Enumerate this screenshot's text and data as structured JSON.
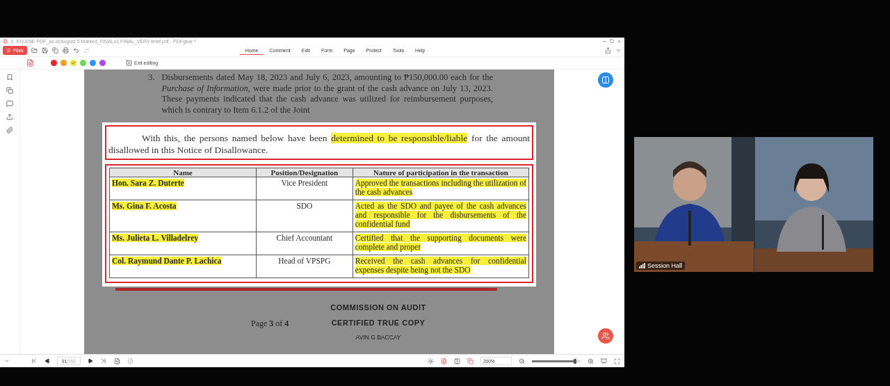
{
  "window": {
    "title": "3. XYLENE PDF_as of August 5 Marked_FINALv1 FINAL_VERY brief.pdf - PDFgear *"
  },
  "files_button": "Files",
  "menu_tabs": [
    {
      "label": "Home",
      "selected": true
    },
    {
      "label": "Comment",
      "selected": false
    },
    {
      "label": "Edit",
      "selected": false
    },
    {
      "label": "Form",
      "selected": false
    },
    {
      "label": "Page",
      "selected": false
    },
    {
      "label": "Protect",
      "selected": false
    },
    {
      "label": "Tools",
      "selected": false
    },
    {
      "label": "Help",
      "selected": false
    }
  ],
  "highlight_colors": [
    {
      "color": "#e8262b",
      "selected": false
    },
    {
      "color": "#f59b1b",
      "selected": false
    },
    {
      "color": "#f5e62a",
      "selected": true
    },
    {
      "color": "#6fd656",
      "selected": false
    },
    {
      "color": "#2d95ee",
      "selected": false
    },
    {
      "color": "#b04be0",
      "selected": false
    }
  ],
  "exit_editing": "Exit editing",
  "document": {
    "item_number": "3.",
    "item_text": "Disbursements dated May 18, 2023 and July 6, 2023, amounting to ₱150,000.00 each for the *Purchase of Information*, were made prior to the grant of the cash advance on July 13, 2023. These payments indicated that the cash advance was utilized for reimbursement purposes, which is contrary to Item 6.1.2 of the Joint",
    "statement": [
      {
        "text": "With this, the persons named below have been ",
        "highlighted": false
      },
      {
        "text": "determined to be responsible/liable",
        "highlighted": true
      },
      {
        "text": " for the amount disallowed in this Notice of Disallowance.",
        "highlighted": false
      }
    ],
    "table": {
      "columns": [
        "Name",
        "Position/Designation",
        "Nature of participation in the transaction"
      ],
      "rows": [
        {
          "name": "Hon. Sara Z. Duterte",
          "position": "Vice President",
          "nature": "Approved the transactions including the utilization of the cash advances",
          "highlighted": true
        },
        {
          "name": "Ms. Gina F. Acosta",
          "position": "SDO",
          "nature": "Acted as the SDO and payee of the cash advances and responsible for the disbursements of the confidential fund",
          "highlighted": true
        },
        {
          "name": "Ms. Julieta L. Villadelrey",
          "position": "Chief Accountant",
          "nature": "Certified that the supporting documents were complete and proper",
          "highlighted": true
        },
        {
          "name": "Col. Raymund Dante P. Lachica",
          "position": "Head of VPSPG",
          "nature": "Received the cash advances for confidential expenses despite being not the SDO",
          "highlighted": true
        }
      ]
    },
    "page_label": "Page **3** of **4**",
    "stamp": [
      "COMMISSION ON AUDIT",
      "CERTIFIED TRUE COPY",
      "AVIN G BACCAY"
    ]
  },
  "status_bar": {
    "page": "91",
    "page_total": "/200",
    "zoom": "200%",
    "zoom_slider": {
      "level": 0.85
    }
  },
  "video": {
    "caption": "Session Hall"
  }
}
